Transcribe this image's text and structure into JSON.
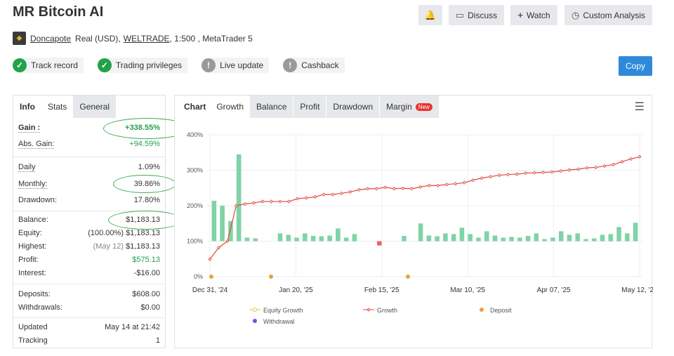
{
  "title": "MR Bitcoin AI",
  "top_buttons": {
    "discuss": "Discuss",
    "watch": "Watch",
    "custom": "Custom Analysis"
  },
  "account": {
    "user": "Doncapote",
    "type": "Real (USD),",
    "broker": "WELTRADE",
    "rest": ", 1:500 , MetaTrader 5"
  },
  "badges": [
    {
      "label": "Track record",
      "status": "ok"
    },
    {
      "label": "Trading privileges",
      "status": "ok"
    },
    {
      "label": "Live update",
      "status": "warn"
    },
    {
      "label": "Cashback",
      "status": "warn"
    }
  ],
  "copy_label": "Copy",
  "left_tabs": [
    "Info",
    "Stats",
    "General"
  ],
  "stats": {
    "gain_label": "Gain :",
    "gain": "+338.55%",
    "abs_gain_label": "Abs. Gain:",
    "abs_gain": "+94.59%",
    "daily_label": "Daily",
    "daily": "1.09%",
    "monthly_label": "Monthly:",
    "monthly": "39.86%",
    "drawdown_label": "Drawdown:",
    "drawdown": "17.80%",
    "balance_label": "Balance:",
    "balance": "$1,183.13",
    "equity_label": "Equity:",
    "equity_pct": "(100.00%)",
    "equity": "$1,183.13",
    "highest_label": "Highest:",
    "highest_date": "(May 12)",
    "highest": "$1,183.13",
    "profit_label": "Profit:",
    "profit": "$575.13",
    "interest_label": "Interest:",
    "interest": "-$16.00",
    "deposits_label": "Deposits:",
    "deposits": "$608.00",
    "withdrawals_label": "Withdrawals:",
    "withdrawals": "$0.00",
    "updated_label": "Updated",
    "updated": "May 14 at 21:42",
    "tracking_label": "Tracking",
    "tracking": "1"
  },
  "chart_tabs": {
    "chart": "Chart",
    "growth": "Growth",
    "balance": "Balance",
    "profit": "Profit",
    "drawdown": "Drawdown",
    "margin": "Margin",
    "new": "New"
  },
  "legend": {
    "equity": "Equity Growth",
    "growth": "Growth",
    "deposit": "Deposit",
    "withdrawal": "Withdrawal"
  },
  "colors": {
    "growth_line": "#e0473b",
    "bars": "#7fd3a7",
    "negative_bar": "#f0606a",
    "deposit": "#e8a23a",
    "withdrawal": "#5b5ce0",
    "equity": "#e8c23a",
    "accent": "#2e8ad8",
    "ok": "#22a14a",
    "warn": "#9a9a9a"
  },
  "chart_data": {
    "type": "line",
    "x_ticks": [
      "Dec 31, '24",
      "Jan 20, '25",
      "Feb 15, '25",
      "Mar 10, '25",
      "Apr 07, '25",
      "May 12, '25"
    ],
    "y_ticks": [
      "400%",
      "300%",
      "200%",
      "100%",
      "0%"
    ],
    "ylim": [
      0,
      400
    ],
    "growth": [
      49,
      82,
      100,
      200,
      205,
      208,
      212,
      212,
      212,
      212,
      220,
      222,
      225,
      232,
      232,
      235,
      239,
      245,
      248,
      248,
      252,
      248,
      249,
      248,
      253,
      257,
      257,
      260,
      262,
      265,
      272,
      278,
      282,
      286,
      288,
      289,
      292,
      293,
      294,
      295,
      298,
      301,
      303,
      307,
      308,
      312,
      316,
      324,
      332,
      338
    ],
    "bars": [
      114,
      100,
      57,
      245,
      10,
      8,
      0,
      0,
      22,
      18,
      10,
      22,
      15,
      14,
      16,
      36,
      10,
      20,
      0,
      0,
      -12,
      0,
      0,
      15,
      0,
      50,
      16,
      14,
      22,
      20,
      38,
      20,
      10,
      28,
      16,
      10,
      12,
      10,
      15,
      22,
      6,
      10,
      28,
      18,
      22,
      6,
      8,
      18,
      20,
      40,
      22,
      52
    ],
    "deposits_at": [
      0,
      1,
      2
    ]
  }
}
